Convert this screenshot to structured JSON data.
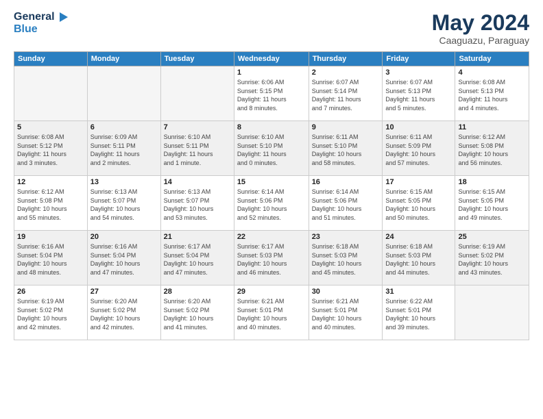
{
  "header": {
    "logo_general": "General",
    "logo_blue": "Blue",
    "month_title": "May 2024",
    "location": "Caaguazu, Paraguay"
  },
  "weekdays": [
    "Sunday",
    "Monday",
    "Tuesday",
    "Wednesday",
    "Thursday",
    "Friday",
    "Saturday"
  ],
  "weeks": [
    [
      {
        "day": "",
        "info": ""
      },
      {
        "day": "",
        "info": ""
      },
      {
        "day": "",
        "info": ""
      },
      {
        "day": "1",
        "info": "Sunrise: 6:06 AM\nSunset: 5:15 PM\nDaylight: 11 hours\nand 8 minutes."
      },
      {
        "day": "2",
        "info": "Sunrise: 6:07 AM\nSunset: 5:14 PM\nDaylight: 11 hours\nand 7 minutes."
      },
      {
        "day": "3",
        "info": "Sunrise: 6:07 AM\nSunset: 5:13 PM\nDaylight: 11 hours\nand 5 minutes."
      },
      {
        "day": "4",
        "info": "Sunrise: 6:08 AM\nSunset: 5:13 PM\nDaylight: 11 hours\nand 4 minutes."
      }
    ],
    [
      {
        "day": "5",
        "info": "Sunrise: 6:08 AM\nSunset: 5:12 PM\nDaylight: 11 hours\nand 3 minutes."
      },
      {
        "day": "6",
        "info": "Sunrise: 6:09 AM\nSunset: 5:11 PM\nDaylight: 11 hours\nand 2 minutes."
      },
      {
        "day": "7",
        "info": "Sunrise: 6:10 AM\nSunset: 5:11 PM\nDaylight: 11 hours\nand 1 minute."
      },
      {
        "day": "8",
        "info": "Sunrise: 6:10 AM\nSunset: 5:10 PM\nDaylight: 11 hours\nand 0 minutes."
      },
      {
        "day": "9",
        "info": "Sunrise: 6:11 AM\nSunset: 5:10 PM\nDaylight: 10 hours\nand 58 minutes."
      },
      {
        "day": "10",
        "info": "Sunrise: 6:11 AM\nSunset: 5:09 PM\nDaylight: 10 hours\nand 57 minutes."
      },
      {
        "day": "11",
        "info": "Sunrise: 6:12 AM\nSunset: 5:08 PM\nDaylight: 10 hours\nand 56 minutes."
      }
    ],
    [
      {
        "day": "12",
        "info": "Sunrise: 6:12 AM\nSunset: 5:08 PM\nDaylight: 10 hours\nand 55 minutes."
      },
      {
        "day": "13",
        "info": "Sunrise: 6:13 AM\nSunset: 5:07 PM\nDaylight: 10 hours\nand 54 minutes."
      },
      {
        "day": "14",
        "info": "Sunrise: 6:13 AM\nSunset: 5:07 PM\nDaylight: 10 hours\nand 53 minutes."
      },
      {
        "day": "15",
        "info": "Sunrise: 6:14 AM\nSunset: 5:06 PM\nDaylight: 10 hours\nand 52 minutes."
      },
      {
        "day": "16",
        "info": "Sunrise: 6:14 AM\nSunset: 5:06 PM\nDaylight: 10 hours\nand 51 minutes."
      },
      {
        "day": "17",
        "info": "Sunrise: 6:15 AM\nSunset: 5:05 PM\nDaylight: 10 hours\nand 50 minutes."
      },
      {
        "day": "18",
        "info": "Sunrise: 6:15 AM\nSunset: 5:05 PM\nDaylight: 10 hours\nand 49 minutes."
      }
    ],
    [
      {
        "day": "19",
        "info": "Sunrise: 6:16 AM\nSunset: 5:04 PM\nDaylight: 10 hours\nand 48 minutes."
      },
      {
        "day": "20",
        "info": "Sunrise: 6:16 AM\nSunset: 5:04 PM\nDaylight: 10 hours\nand 47 minutes."
      },
      {
        "day": "21",
        "info": "Sunrise: 6:17 AM\nSunset: 5:04 PM\nDaylight: 10 hours\nand 47 minutes."
      },
      {
        "day": "22",
        "info": "Sunrise: 6:17 AM\nSunset: 5:03 PM\nDaylight: 10 hours\nand 46 minutes."
      },
      {
        "day": "23",
        "info": "Sunrise: 6:18 AM\nSunset: 5:03 PM\nDaylight: 10 hours\nand 45 minutes."
      },
      {
        "day": "24",
        "info": "Sunrise: 6:18 AM\nSunset: 5:03 PM\nDaylight: 10 hours\nand 44 minutes."
      },
      {
        "day": "25",
        "info": "Sunrise: 6:19 AM\nSunset: 5:02 PM\nDaylight: 10 hours\nand 43 minutes."
      }
    ],
    [
      {
        "day": "26",
        "info": "Sunrise: 6:19 AM\nSunset: 5:02 PM\nDaylight: 10 hours\nand 42 minutes."
      },
      {
        "day": "27",
        "info": "Sunrise: 6:20 AM\nSunset: 5:02 PM\nDaylight: 10 hours\nand 42 minutes."
      },
      {
        "day": "28",
        "info": "Sunrise: 6:20 AM\nSunset: 5:02 PM\nDaylight: 10 hours\nand 41 minutes."
      },
      {
        "day": "29",
        "info": "Sunrise: 6:21 AM\nSunset: 5:01 PM\nDaylight: 10 hours\nand 40 minutes."
      },
      {
        "day": "30",
        "info": "Sunrise: 6:21 AM\nSunset: 5:01 PM\nDaylight: 10 hours\nand 40 minutes."
      },
      {
        "day": "31",
        "info": "Sunrise: 6:22 AM\nSunset: 5:01 PM\nDaylight: 10 hours\nand 39 minutes."
      },
      {
        "day": "",
        "info": ""
      }
    ]
  ]
}
